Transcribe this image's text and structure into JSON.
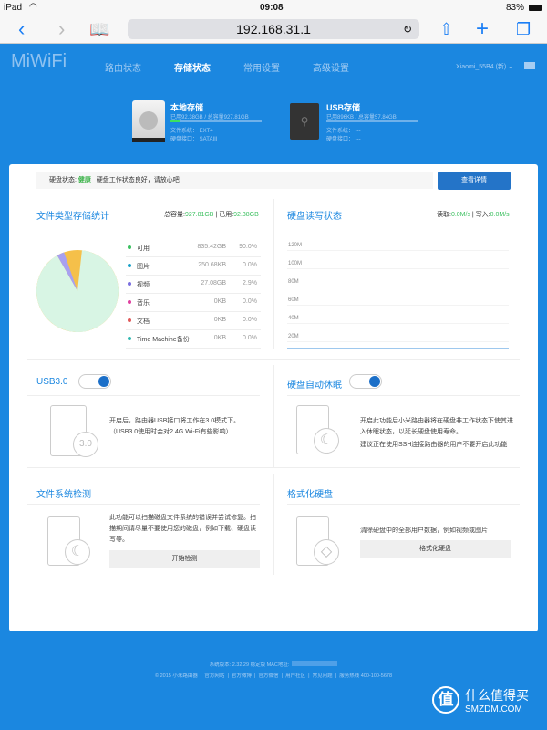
{
  "status_bar": {
    "device": "iPad",
    "time": "09:08",
    "battery": "83%"
  },
  "browser": {
    "url": "192.168.31.1"
  },
  "header": {
    "logo": "MiWiFi",
    "tabs": [
      {
        "label": "路由状态"
      },
      {
        "label": "存储状态"
      },
      {
        "label": "常用设置"
      },
      {
        "label": "高级设置"
      }
    ],
    "network": "Xiaomi_55B4 (新)"
  },
  "disks": {
    "local": {
      "title": "本地存储",
      "usage": "已用92.38GB / 总容量927.81GB",
      "used_fraction": 0.1,
      "fs": "文件系统： EXT4",
      "port": "硬盘接口： SATAIII"
    },
    "usb": {
      "title": "USB存储",
      "usage": "已用896KB / 总容量57.84GB",
      "used_fraction": 0,
      "fs": "文件系统： ---",
      "port": "硬盘接口： ---"
    }
  },
  "health": {
    "label": "硬盘状态:",
    "status": "健康",
    "message": "硬盘工作状态良好，请放心吧",
    "button": "查看详情"
  },
  "file_stats": {
    "title": "文件类型存储统计",
    "total_label": "总容量:",
    "total": "927.81GB",
    "used_label": "已用:",
    "used": "92.38GB",
    "items": [
      {
        "label": "可用",
        "size": "835.42GB",
        "percent": "90.0%",
        "value": 90.0,
        "color": "#3cc060"
      },
      {
        "label": "图片",
        "size": "250.68KB",
        "percent": "0.0%",
        "value": 0,
        "color": "#18a0c8"
      },
      {
        "label": "视频",
        "size": "27.08GB",
        "percent": "2.9%",
        "value": 2.9,
        "color": "#7b6fe0"
      },
      {
        "label": "音乐",
        "size": "0KB",
        "percent": "0.0%",
        "value": 0,
        "color": "#e040a0"
      },
      {
        "label": "文档",
        "size": "0KB",
        "percent": "0.0%",
        "value": 0,
        "color": "#e05a5a"
      },
      {
        "label": "Time Machine备份",
        "size": "0KB",
        "percent": "0.0%",
        "value": 0,
        "color": "#30b8b0"
      }
    ]
  },
  "chart_data": {
    "type": "line",
    "title": "硬盘读写状态",
    "read_label": "读取:",
    "read": "0.0M/s",
    "write_label": "写入:",
    "write": "0.0M/s",
    "yticks": [
      "120M",
      "100M",
      "80M",
      "60M",
      "40M",
      "20M"
    ],
    "ylim": [
      0,
      130
    ],
    "series": [
      {
        "name": "读取",
        "values": []
      },
      {
        "name": "写入",
        "values": []
      }
    ]
  },
  "usb3": {
    "title": "USB3.0",
    "enabled": true,
    "desc1": "开启后，路由器USB接口将工作在3.0模式下。",
    "desc2": "（USB3.0使用时会对2.4G Wi-Fi有些影响）",
    "icon_text": "3.0"
  },
  "sleep": {
    "title": "硬盘自动休眠",
    "enabled": true,
    "desc1": "开启此功能后小米路由器将在硬盘非工作状态下使其进入休眠状态，以延长硬盘使用寿命。",
    "desc2": "建议正在使用SSH连接路由器的用户不要开启此功能"
  },
  "fscheck": {
    "title": "文件系统检测",
    "desc": "此功能可以扫描磁盘文件系统的错误并尝试修复。扫描期间请尽量不要使用您的磁盘，例如下载、硬盘读写等。",
    "button": "开始检测"
  },
  "format": {
    "title": "格式化硬盘",
    "desc": "清除硬盘中的全部用户数据，例如视频或图片",
    "button": "格式化硬盘"
  },
  "footer": {
    "version": "系统版本: 2.32.29 稳定版  MAC地址:",
    "links": [
      "© 2015 小米路由器",
      "官方网站",
      "官方微博",
      "官方微信",
      "用户社区",
      "常见问题",
      "服务热线 400-100-5678"
    ]
  },
  "watermark": {
    "cn": "什么值得买",
    "en": "SMZDM.COM",
    "seal": "值"
  }
}
